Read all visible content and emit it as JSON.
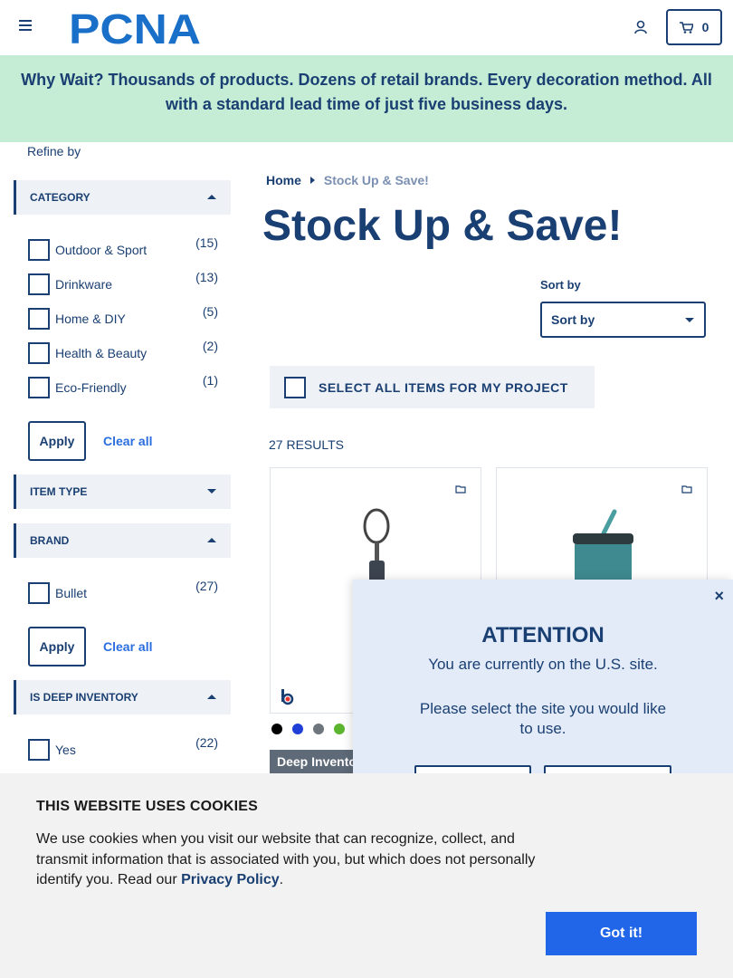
{
  "header": {
    "logo_alt": "PCNA",
    "cart_count": "0"
  },
  "banner": {
    "text": "Why Wait? Thousands of products. Dozens of retail brands. Every decoration method. All with a standard lead time of just five business days."
  },
  "sidebar": {
    "refine_label": "Refine by",
    "category": {
      "title": "CATEGORY",
      "options": [
        {
          "label": "Outdoor & Sport",
          "count": "(15)"
        },
        {
          "label": "Drinkware",
          "count": "(13)"
        },
        {
          "label": "Home & DIY",
          "count": "(5)"
        },
        {
          "label": "Health & Beauty",
          "count": "(2)"
        },
        {
          "label": "Eco-Friendly",
          "count": "(1)"
        }
      ]
    },
    "apply_label": "Apply",
    "clear_label": "Clear all",
    "item_type": {
      "title": "ITEM TYPE"
    },
    "brand": {
      "title": "BRAND",
      "options": [
        {
          "label": "Bullet",
          "count": "(27)"
        }
      ]
    },
    "deep_inventory": {
      "title": "IS DEEP INVENTORY",
      "options": [
        {
          "label": "Yes",
          "count": "(22)"
        }
      ]
    }
  },
  "breadcrumb": {
    "home": "Home",
    "current": "Stock Up & Save!"
  },
  "page_title": "Stock Up & Save!",
  "sort": {
    "label": "Sort by",
    "selected": "Sort by"
  },
  "select_all_label": "SELECT ALL ITEMS FOR MY PROJECT",
  "results_label": "27 RESULTS",
  "products": [
    {
      "badge": "Deep Inventory",
      "swatches": [
        "#000000",
        "#1f3fd6",
        "#6e757c",
        "#5bb52f"
      ]
    },
    {}
  ],
  "modal": {
    "title": "ATTENTION",
    "line1": "You are currently on the U.S. site.",
    "line2": "Please select the site you would like to use.",
    "close": "×"
  },
  "cookie": {
    "title": "THIS WEBSITE USES COOKIES",
    "text": "We use cookies when you visit our website that can recognize, collect, and transmit information that is associated with you, but which does not personally identify you. Read our",
    "link": "Privacy Policy",
    "period": ".",
    "button": "Got it!"
  }
}
